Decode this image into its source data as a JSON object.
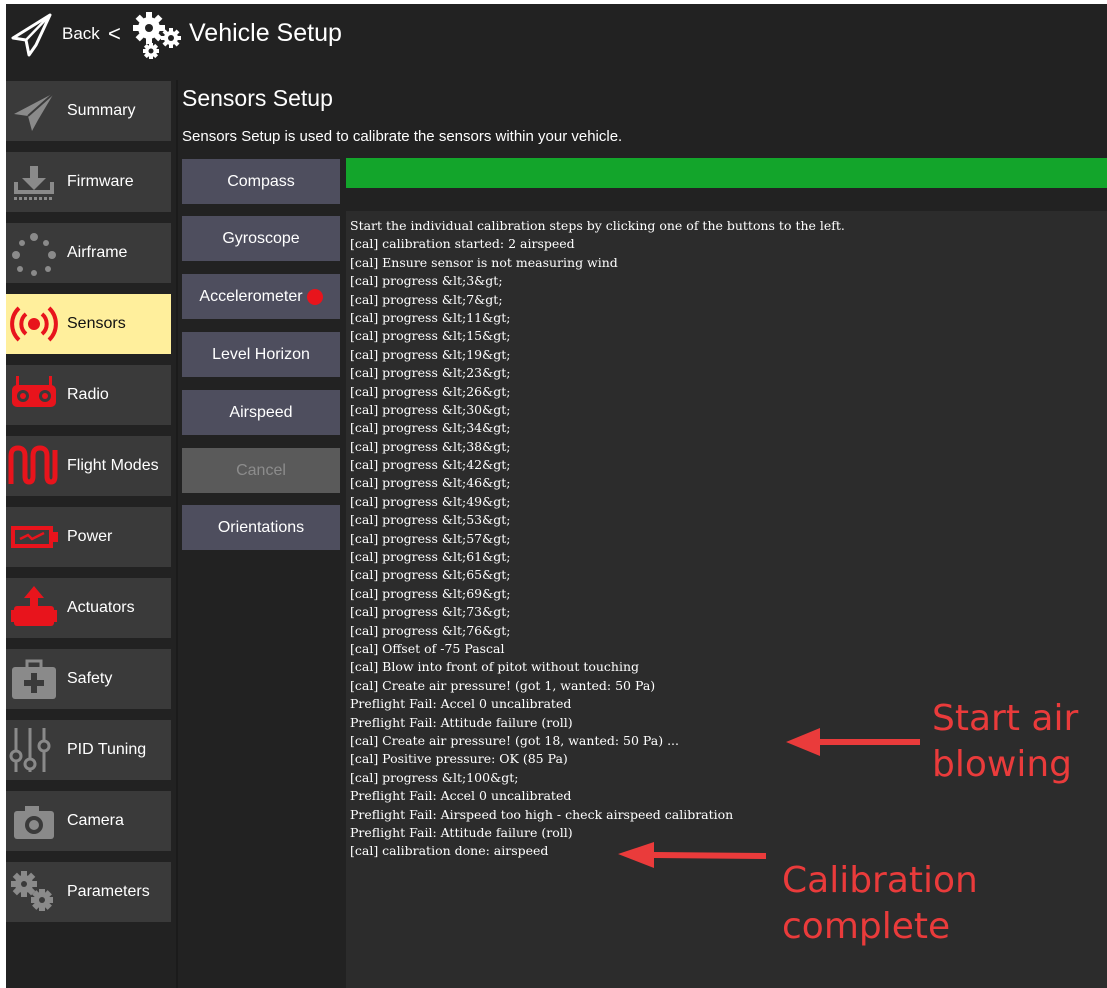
{
  "header": {
    "back_label": "Back",
    "back_chevron": "<",
    "title": "Vehicle Setup"
  },
  "sidebar": {
    "items": [
      {
        "label": "Summary",
        "icon": "paper-plane-icon"
      },
      {
        "label": "Firmware",
        "icon": "download-icon"
      },
      {
        "label": "Airframe",
        "icon": "airframe-dots-icon"
      },
      {
        "label": "Sensors",
        "icon": "sensor-broadcast-icon",
        "active": true
      },
      {
        "label": "Radio",
        "icon": "radio-transmitter-icon"
      },
      {
        "label": "Flight Modes",
        "icon": "flight-modes-wave-icon"
      },
      {
        "label": "Power",
        "icon": "battery-icon"
      },
      {
        "label": "Actuators",
        "icon": "actuator-icon"
      },
      {
        "label": "Safety",
        "icon": "first-aid-kit-icon"
      },
      {
        "label": "PID Tuning",
        "icon": "sliders-icon"
      },
      {
        "label": "Camera",
        "icon": "camera-icon"
      },
      {
        "label": "Parameters",
        "icon": "gears-icon"
      }
    ]
  },
  "page": {
    "title": "Sensors Setup",
    "description": "Sensors Setup is used to calibrate the sensors within your vehicle."
  },
  "buttons": {
    "compass": "Compass",
    "gyroscope": "Gyroscope",
    "accelerometer": "Accelerometer",
    "level_horizon": "Level Horizon",
    "airspeed": "Airspeed",
    "cancel": "Cancel",
    "orientations": "Orientations"
  },
  "progress": {
    "fraction": 1.0
  },
  "log": [
    "Start the individual calibration steps by clicking one of the buttons to the left.",
    "[cal] calibration started: 2 airspeed",
    "[cal] Ensure sensor is not measuring wind",
    "[cal] progress &lt;3&gt;",
    "[cal] progress &lt;7&gt;",
    "[cal] progress &lt;11&gt;",
    "[cal] progress &lt;15&gt;",
    "[cal] progress &lt;19&gt;",
    "[cal] progress &lt;23&gt;",
    "[cal] progress &lt;26&gt;",
    "[cal] progress &lt;30&gt;",
    "[cal] progress &lt;34&gt;",
    "[cal] progress &lt;38&gt;",
    "[cal] progress &lt;42&gt;",
    "[cal] progress &lt;46&gt;",
    "[cal] progress &lt;49&gt;",
    "[cal] progress &lt;53&gt;",
    "[cal] progress &lt;57&gt;",
    "[cal] progress &lt;61&gt;",
    "[cal] progress &lt;65&gt;",
    "[cal] progress &lt;69&gt;",
    "[cal] progress &lt;73&gt;",
    "[cal] progress &lt;76&gt;",
    "[cal] Offset of -75 Pascal",
    "[cal] Blow into front of pitot without touching",
    "[cal] Create air pressure! (got 1, wanted: 50 Pa)",
    "Preflight Fail: Accel 0 uncalibrated",
    "Preflight Fail: Attitude failure (roll)",
    "[cal] Create air pressure! (got 18, wanted: 50 Pa) ...",
    "[cal] Positive pressure: OK (85 Pa)",
    "[cal] progress &lt;100&gt;",
    "Preflight Fail: Accel 0 uncalibrated",
    "Preflight Fail: Airspeed too high - check airspeed calibration",
    "Preflight Fail: Attitude failure (roll)",
    "[cal] calibration done: airspeed"
  ],
  "annotations": {
    "start_air_line1": "Start air",
    "start_air_line2": "blowing",
    "calibration_line1": "Calibration",
    "calibration_line2": "complete"
  },
  "colors": {
    "background": "#222222",
    "sidebar_item": "#3a3a3a",
    "active_item": "#ffef9c",
    "button": "#4e4e5e",
    "progress": "#13a52b",
    "icon_red": "#e8141c",
    "annotation": "#ea3b3b"
  }
}
